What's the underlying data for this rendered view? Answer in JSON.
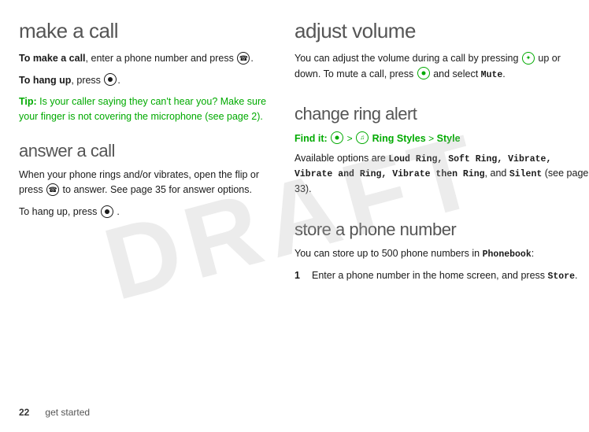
{
  "page": {
    "number": "22",
    "footer_label": "get started",
    "watermark": "DRAFT"
  },
  "left": {
    "make_call": {
      "title": "make a call",
      "para1_prefix": "To make a call",
      "para1_suffix": ", enter a phone number and press",
      "para2_prefix": "To hang up",
      "para2_suffix": ", press",
      "tip_label": "Tip:",
      "tip_text": " Is your caller saying they can't hear you? Make sure your finger is not covering the microphone (see page 2)."
    },
    "answer_call": {
      "title": "answer a call",
      "para1": "When your phone rings and/or vibrates, open the flip or press",
      "para1_suffix": " to answer. See page 35 for answer options.",
      "para2_prefix": "To hang up, press",
      "para2_suffix": "."
    }
  },
  "right": {
    "adjust_volume": {
      "title": "adjust volume",
      "para1_prefix": "You can adjust the volume during a call by pressing",
      "para1_middle": " up or down. To mute a call, press",
      "para1_suffix": " and select",
      "mute_label": "Mute",
      "mute_suffix": "."
    },
    "change_ring_alert": {
      "title": "change ring alert",
      "find_it_label": "Find it:",
      "find_it_arrow": ">",
      "ring_styles_label": "Ring Styles",
      "style_arrow": ">",
      "style_label": "Style",
      "para1": "Available options are",
      "options": "Loud Ring,  Soft Ring,  Vibrate,  Vibrate and Ring,  Vibrate then Ring",
      "and_text": "and",
      "silent_label": "Silent",
      "see_page": "(see page 33)."
    },
    "store_phone_number": {
      "title": "store a phone number",
      "para1_prefix": "You can store up to 500 phone numbers in",
      "phonebook_label": "Phonebook",
      "para1_suffix": ":",
      "step1_num": "1",
      "step1_text": "Enter a phone number in the home screen, and press",
      "store_label": "Store",
      "step1_suffix": "."
    }
  }
}
